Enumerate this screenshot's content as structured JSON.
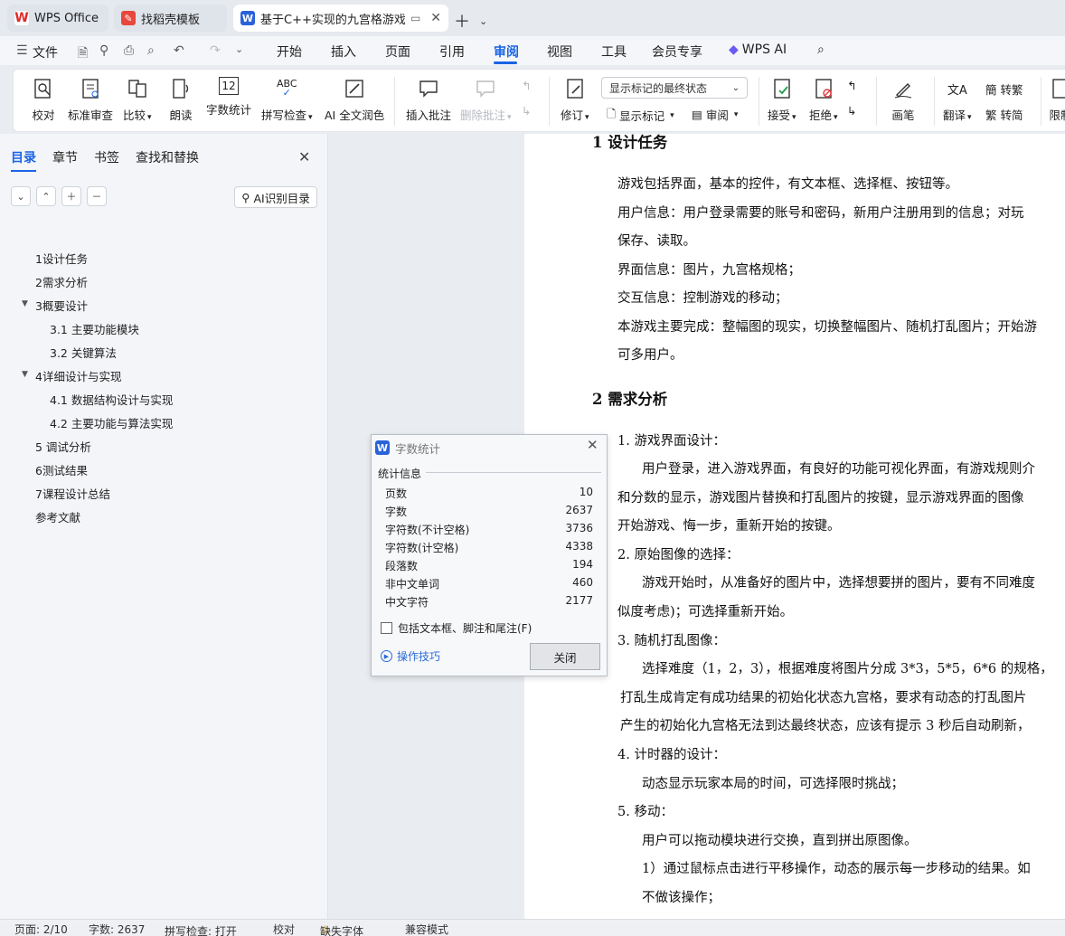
{
  "tabs": [
    {
      "label": "WPS Office"
    },
    {
      "label": "找稻壳模板"
    },
    {
      "label": "基于C++实现的九宫格游戏的"
    }
  ],
  "menu": {
    "file": "文件",
    "items": [
      "开始",
      "插入",
      "页面",
      "引用",
      "审阅",
      "视图",
      "工具",
      "会员专享"
    ],
    "active": "审阅",
    "ai": "WPS AI"
  },
  "ribbon": {
    "proof": "校对",
    "std_review": "标准审查",
    "compare": "比较",
    "read_aloud": "朗读",
    "word_count": "字数统计",
    "spell_check": "拼写检查",
    "ai_polish": "AI 全文润色",
    "insert_comment": "插入批注",
    "delete_comment": "删除批注",
    "track": "修订",
    "markup_select": "显示标记的最终状态",
    "show_markup": "显示标记",
    "review": "审阅",
    "accept": "接受",
    "reject": "拒绝",
    "brush": "画笔",
    "translate": "翻译",
    "to_trad": "转繁",
    "to_simp": "转简",
    "restrict": "限制"
  },
  "nav": {
    "tabs": [
      "目录",
      "章节",
      "书签",
      "查找和替换"
    ],
    "ai_toc": "AI识别目录",
    "toc": [
      {
        "label": "1设计任务"
      },
      {
        "label": "2需求分析"
      },
      {
        "label": "3概要设计"
      },
      {
        "label": "3.1 主要功能模块"
      },
      {
        "label": "3.2 关键算法"
      },
      {
        "label": "4详细设计与实现"
      },
      {
        "label": "4.1 数据结构设计与实现"
      },
      {
        "label": "4.2 主要功能与算法实现"
      },
      {
        "label": "5 调试分析"
      },
      {
        "label": "6测试结果"
      },
      {
        "label": "7课程设计总结"
      },
      {
        "label": "参考文献"
      }
    ]
  },
  "doc": {
    "lines": [
      "1  设计任务",
      "游戏包括界面，基本的控件，有文本框、选择框、按钮等。",
      "用户信息：用户登录需要的账号和密码，新用户注册用到的信息；对玩",
      "保存、读取。",
      "界面信息：图片，九宫格规格；",
      "交互信息：控制游戏的移动；",
      "本游戏主要完成：整幅图的现实，切换整幅图片、随机打乱图片；开始游",
      "可多用户。",
      "2  需求分析",
      "1. 游戏界面设计：",
      "用户登录，进入游戏界面，有良好的功能可视化界面，有游戏规则介",
      "和分数的显示，游戏图片替换和打乱图片的按键，显示游戏界面的图像",
      "开始游戏、悔一步，重新开始的按键。",
      "2. 原始图像的选择：",
      "游戏开始时，从准备好的图片中，选择想要拼的图片，要有不同难度",
      "似度考虑)；可选择重新开始。",
      "3. 随机打乱图像：",
      "选择难度（1，2，3），根据难度将图片分成 3*3，5*5，6*6 的规格，",
      "打乱生成肯定有成功结果的初始化状态九宫格，要求有动态的打乱图片",
      "产生的初始化九宫格无法到达最终状态，应该有提示 3 秒后自动刷新，",
      "4. 计时器的设计：",
      "动态显示玩家本局的时间，可选择限时挑战；",
      "5. 移动：",
      "用户可以拖动模块进行交换，直到拼出原图像。",
      "1）通过鼠标点击进行平移操作，动态的展示每一步移动的结果。如",
      "不做该操作；"
    ]
  },
  "dialog": {
    "title": "字数统计",
    "group": "统计信息",
    "stats": [
      {
        "label": "页数",
        "value": "10"
      },
      {
        "label": "字数",
        "value": "2637"
      },
      {
        "label": "字符数(不计空格)",
        "value": "3736"
      },
      {
        "label": "字符数(计空格)",
        "value": "4338"
      },
      {
        "label": "段落数",
        "value": "194"
      },
      {
        "label": "非中文单词",
        "value": "460"
      },
      {
        "label": "中文字符",
        "value": "2177"
      }
    ],
    "checkbox": "包括文本框、脚注和尾注(F)",
    "tips": "操作技巧",
    "close": "关闭"
  },
  "status": {
    "page": "页面: 2/10",
    "words": "字数: 2637",
    "spell": "拼写检查: 打开",
    "proof": "校对",
    "missing_font": "缺失字体",
    "compat": "兼容模式"
  }
}
